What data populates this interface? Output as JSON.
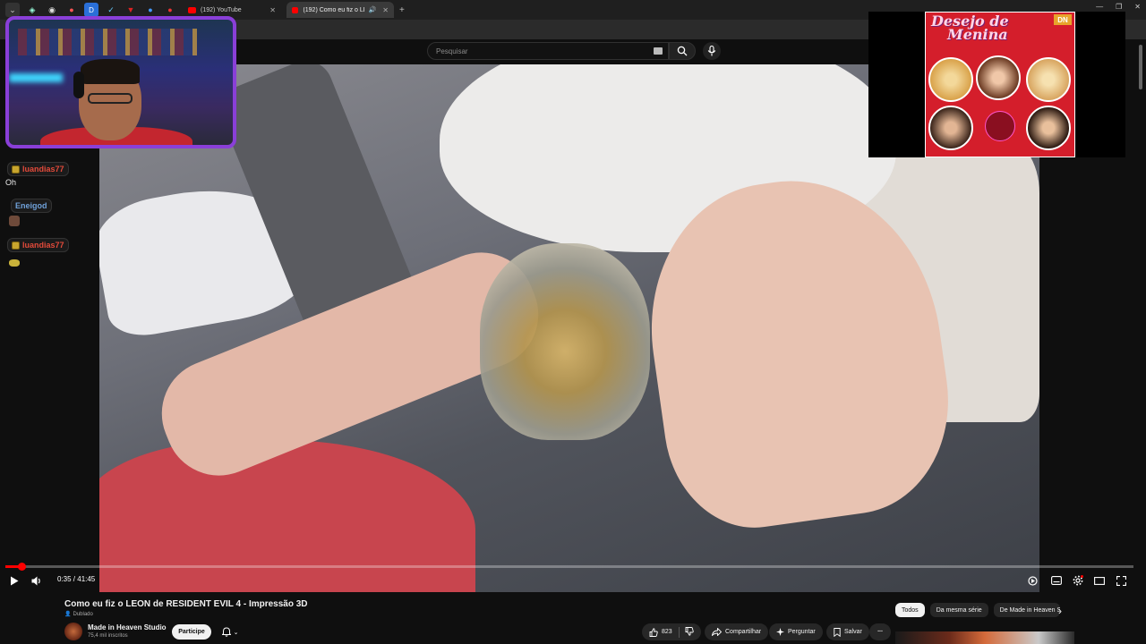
{
  "browser": {
    "tabs": [
      {
        "label": "(192) YouTube",
        "active": false
      },
      {
        "label": "(192) Como eu fiz o LEON",
        "active": true
      }
    ],
    "new_tab_label": "+"
  },
  "header": {
    "search_placeholder": "Pesquisar"
  },
  "player": {
    "time": "0:35 / 41:45",
    "progress_fraction": 0.014,
    "accent_color": "#ff0000"
  },
  "overlay": {
    "chat": [
      {
        "user": "luandias77",
        "message": "Oh"
      },
      {
        "user": "Eneigod",
        "message": ""
      },
      {
        "user": "luandias77",
        "message": ""
      }
    ],
    "album": {
      "title_line1": "Desejo de",
      "title_line2": "Menina",
      "badge": "DN"
    }
  },
  "video": {
    "title": "Como eu fiz o LEON de RESIDENT EVIL 4 - Impressão 3D",
    "dubbed_label": "Dublado",
    "channel_name": "Made in Heaven Studio",
    "subscribers": "75,4 mil inscritos",
    "join_label": "Participe",
    "like_count": "823",
    "share_label": "Compartilhar",
    "ask_label": "Perguntar",
    "save_label": "Salvar",
    "more_label": "..."
  },
  "recommend_chips": [
    "Todos",
    "Da mesma série",
    "De Made in Heaven S"
  ]
}
